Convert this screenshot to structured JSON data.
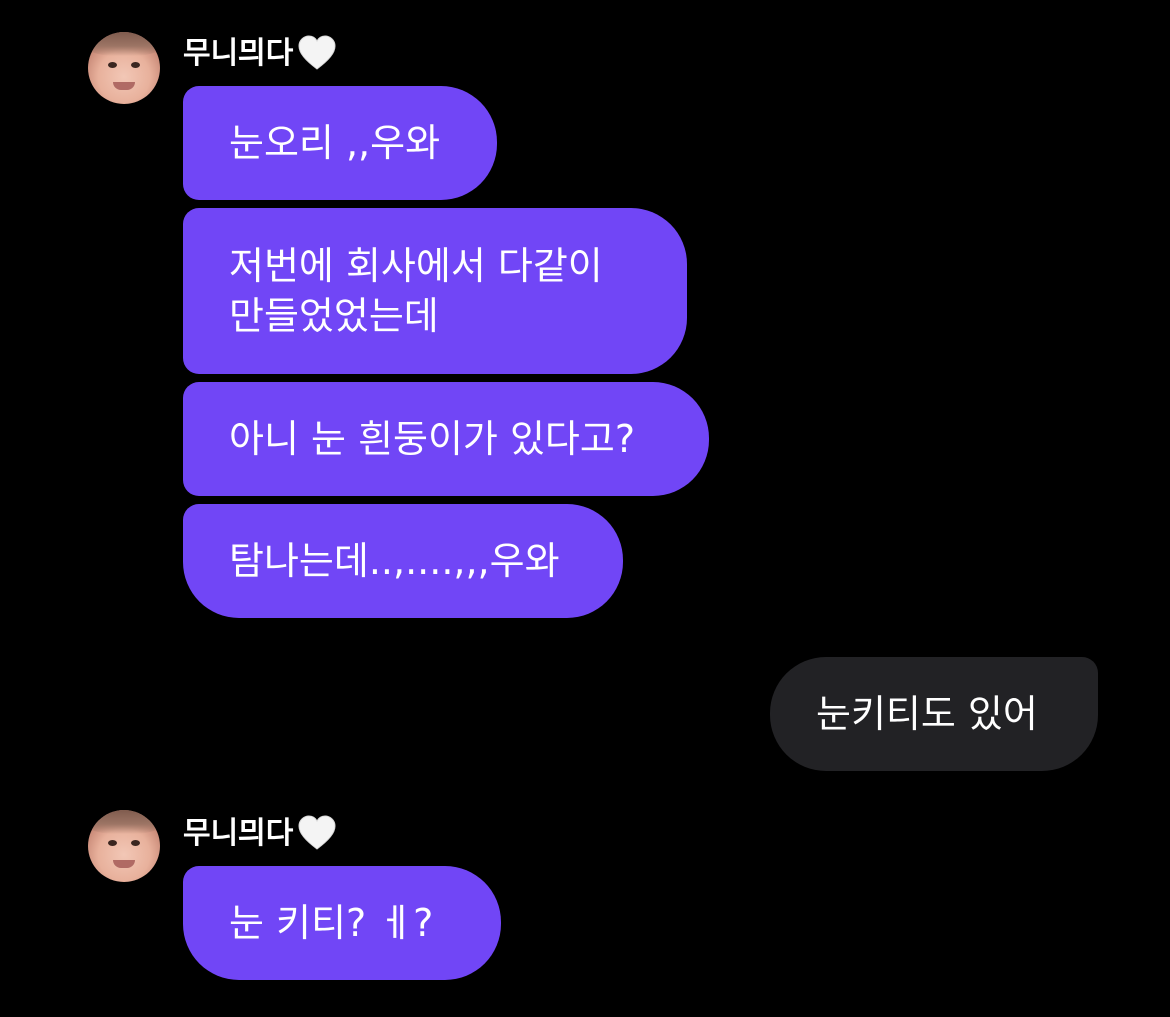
{
  "conversation": {
    "groups": [
      {
        "sender_name": "무니믜다",
        "sender_badge_icon": "white-heart-icon",
        "messages": [
          "눈오리 ,,우와",
          "저번에 회사에서 다같이",
          "만들었었는데",
          "아니 눈 흰둥이가 있다고?",
          "탐나는데..,....,,,우와"
        ]
      },
      {
        "outgoing_message": "눈키티도 있어"
      },
      {
        "sender_name": "무니믜다",
        "sender_badge_icon": "white-heart-icon",
        "messages": [
          "눈 키티? ㅔ?"
        ]
      }
    ]
  },
  "colors": {
    "background": "#000000",
    "incoming_bubble": "#7146f6",
    "outgoing_bubble": "#222225",
    "text": "#ffffff"
  }
}
